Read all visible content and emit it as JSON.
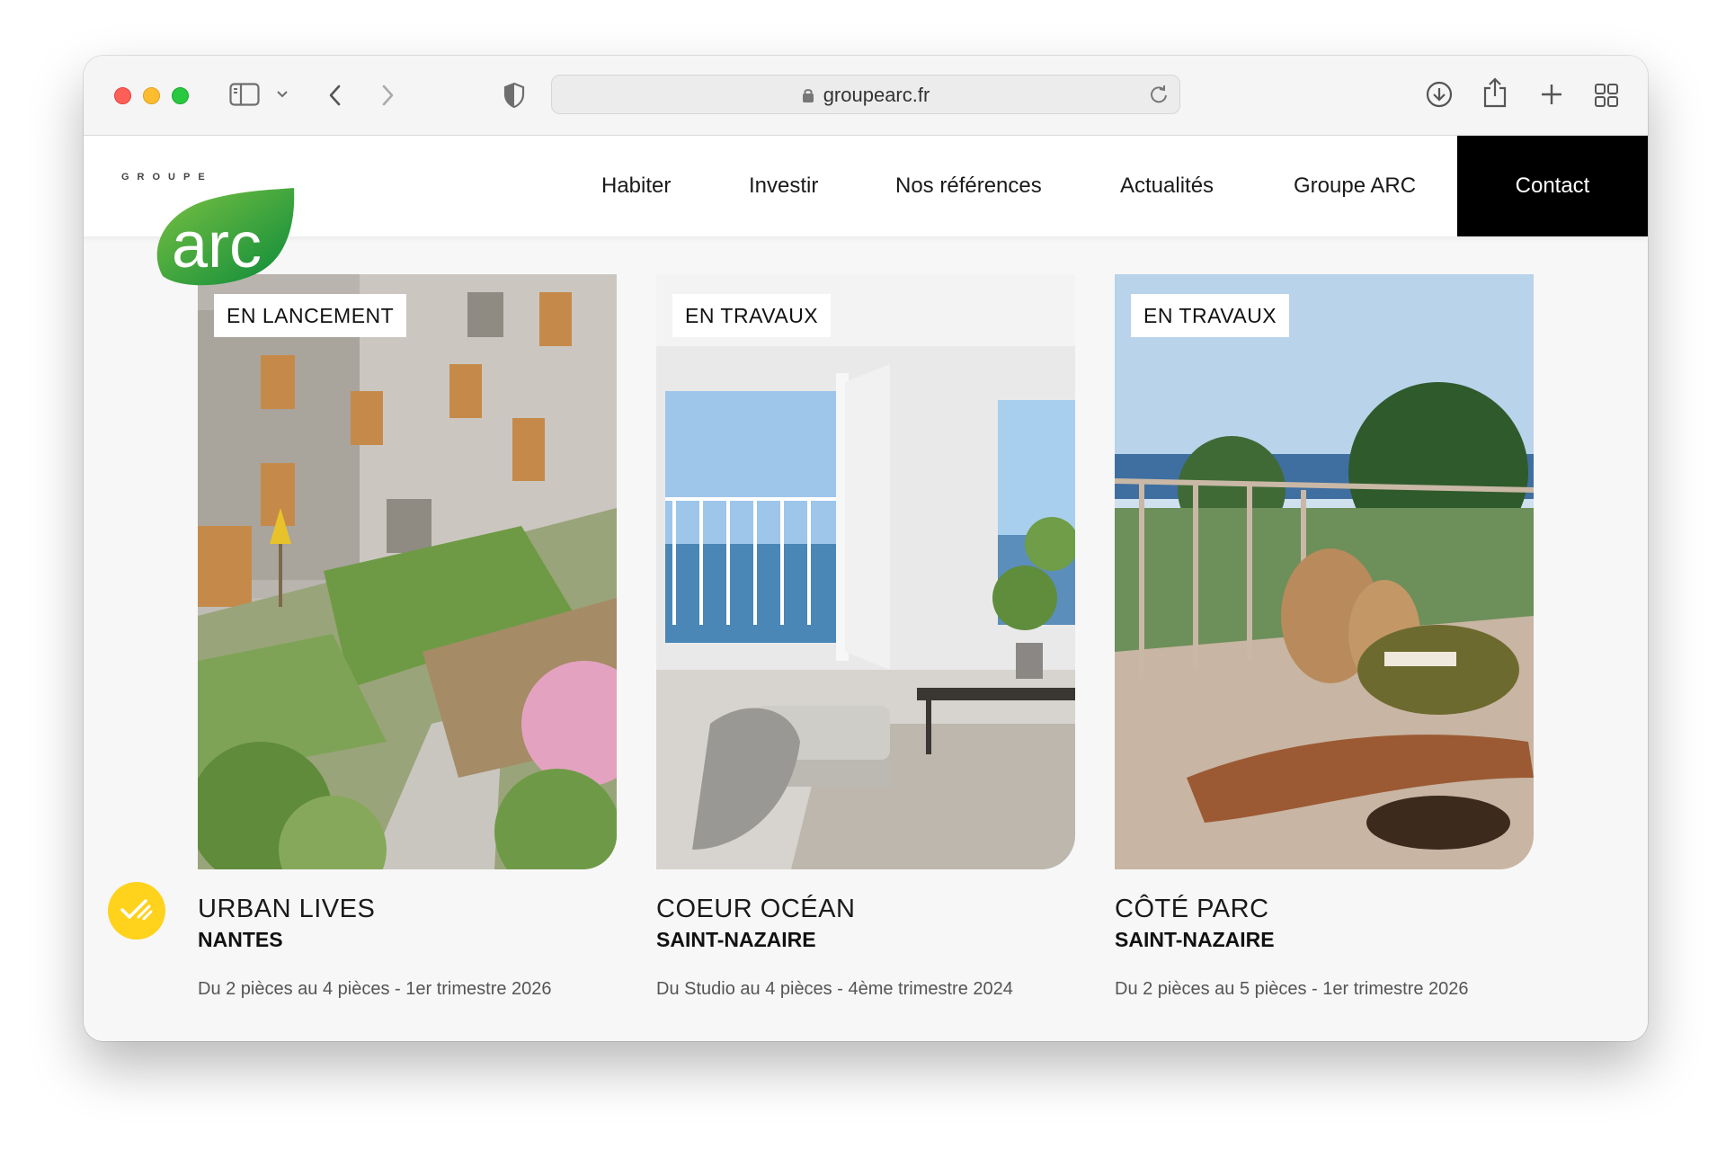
{
  "browser": {
    "url": "groupearc.fr"
  },
  "header": {
    "logo_groupe": "GROUPE",
    "logo_arc": "arc",
    "nav": [
      "Habiter",
      "Investir",
      "Nos références",
      "Actualités",
      "Groupe ARC"
    ],
    "contact": "Contact"
  },
  "programs": [
    {
      "status": "EN LANCEMENT",
      "name": "URBAN LIVES",
      "city": "NANTES",
      "desc": "Du 2 pièces au 4 pièces - 1er trimestre 2026"
    },
    {
      "status": "EN TRAVAUX",
      "name": "COEUR OCÉAN",
      "city": "SAINT-NAZAIRE",
      "desc": "Du Studio au 4 pièces - 4ème trimestre 2024"
    },
    {
      "status": "EN TRAVAUX",
      "name": "CÔTÉ PARC",
      "city": "SAINT-NAZAIRE",
      "desc": "Du 2 pièces au 5 pièces - 1er trimestre 2026"
    }
  ],
  "colors": {
    "brand_green": "#1a9a3c",
    "chat_yellow": "#ffd21c",
    "contact_bg": "#000000"
  }
}
